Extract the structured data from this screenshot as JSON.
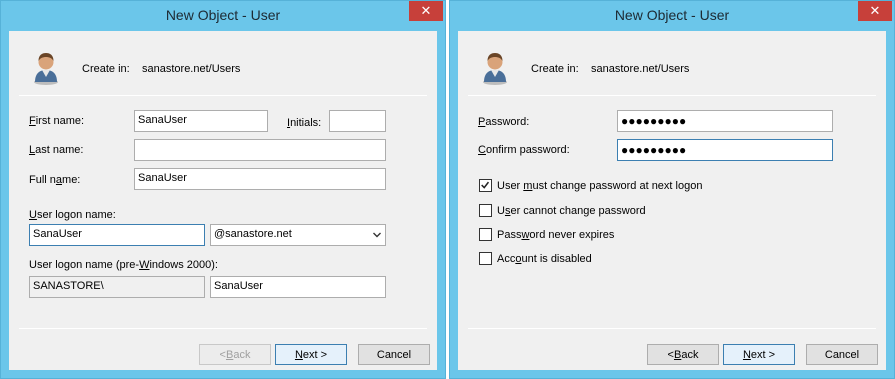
{
  "left_dialog": {
    "title": "New Object - User",
    "close_glyph": "✕",
    "create_in_label": "Create in:",
    "create_in_value": "sanastore.net/Users",
    "first_name_label_u": "F",
    "first_name_label_rest": "irst name:",
    "first_name_value": "SanaUser",
    "initials_label_u": "I",
    "initials_label_rest": "nitials:",
    "initials_value": "",
    "last_name_label_u": "L",
    "last_name_label_rest": "ast name:",
    "last_name_value": "",
    "full_name_label_a": "Full n",
    "full_name_label_u": "a",
    "full_name_label_b": "me:",
    "full_name_value": "SanaUser",
    "logon_name_label_u": "U",
    "logon_name_label_rest": "ser logon name:",
    "logon_name_value": "SanaUser",
    "domain_value": "@sanastore.net",
    "pre2000_label_a": "User logon name (pre-",
    "pre2000_label_u": "W",
    "pre2000_label_b": "indows 2000):",
    "pre2000_domain": "SANASTORE\\",
    "pre2000_value": "SanaUser",
    "back_prefix": "< ",
    "back_u": "B",
    "back_rest": "ack",
    "next_u": "N",
    "next_rest": "ext >",
    "cancel_label": "Cancel"
  },
  "right_dialog": {
    "title": "New Object - User",
    "close_glyph": "✕",
    "create_in_label": "Create in:",
    "create_in_value": "sanastore.net/Users",
    "password_label_u": "P",
    "password_label_rest": "assword:",
    "password_value": "●●●●●●●●●",
    "confirm_label_u": "C",
    "confirm_label_rest": "onfirm password:",
    "confirm_value": "●●●●●●●●●",
    "options": [
      {
        "a": "User ",
        "u": "m",
        "b": "ust change password at next logon",
        "checked": true
      },
      {
        "a": "U",
        "u": "s",
        "b": "er cannot change password",
        "checked": false
      },
      {
        "a": "Pass",
        "u": "w",
        "b": "ord never expires",
        "checked": false
      },
      {
        "a": "Acc",
        "u": "o",
        "b": "unt is disabled",
        "checked": false
      }
    ],
    "back_prefix": "< ",
    "back_u": "B",
    "back_rest": "ack",
    "next_u": "N",
    "next_rest": "ext >",
    "cancel_label": "Cancel"
  },
  "colors": {
    "frame": "#6bc6ea",
    "client": "#f0f0f0",
    "close": "#c7403a",
    "focus_border": "#3c7fb1"
  },
  "icons": [
    "user-avatar-icon",
    "close-icon",
    "chevron-down-icon",
    "checkmark-icon"
  ]
}
